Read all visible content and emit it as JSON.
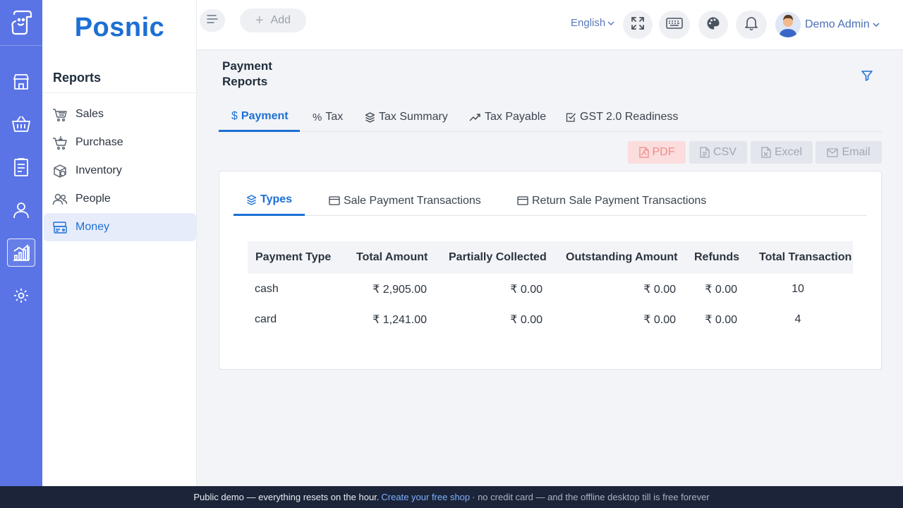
{
  "brand": "Posnic",
  "sidebar": {
    "title": "Reports",
    "items": [
      {
        "label": "Sales"
      },
      {
        "label": "Purchase"
      },
      {
        "label": "Inventory"
      },
      {
        "label": "People"
      },
      {
        "label": "Money"
      }
    ]
  },
  "topbar": {
    "add_label": "Add",
    "language": "English",
    "user_name": "Demo Admin"
  },
  "page": {
    "title": "Payment Reports"
  },
  "tabs": [
    {
      "label": "Payment"
    },
    {
      "label": "Tax"
    },
    {
      "label": "Tax Summary"
    },
    {
      "label": "Tax Payable"
    },
    {
      "label": "GST 2.0 Readiness"
    }
  ],
  "export": {
    "pdf": "PDF",
    "csv": "CSV",
    "excel": "Excel",
    "email": "Email"
  },
  "inner_tabs": [
    {
      "label": "Types"
    },
    {
      "label": "Sale Payment Transactions"
    },
    {
      "label": "Return Sale Payment Transactions"
    }
  ],
  "table": {
    "columns": [
      "Payment Type",
      "Total Amount",
      "Partially Collected",
      "Outstanding Amount",
      "Refunds",
      "Total Transaction"
    ],
    "rows": [
      [
        "cash",
        "₹ 2,905.00",
        "₹ 0.00",
        "₹ 0.00",
        "₹ 0.00",
        "10"
      ],
      [
        "card",
        "₹ 1,241.00",
        "₹ 0.00",
        "₹ 0.00",
        "₹ 0.00",
        "4"
      ]
    ]
  },
  "footer": {
    "text": "Public demo — everything resets on the hour.",
    "link": "Create your free shop",
    "tail": "· no credit card — and the offline desktop till is free forever"
  },
  "colors": {
    "rail": "#5a74e6",
    "accent": "#1c6fd4",
    "footer": "#1b2438"
  }
}
